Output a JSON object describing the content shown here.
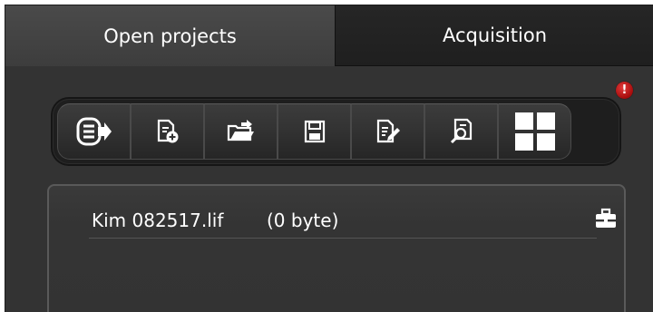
{
  "tabs": [
    {
      "label": "Open projects",
      "active": true
    },
    {
      "label": "Acquisition",
      "active": false
    }
  ],
  "notification": {
    "symbol": "!",
    "color": "#c8161d"
  },
  "toolbar": {
    "buttons": [
      {
        "icon": "list-export-icon"
      },
      {
        "icon": "new-file-icon"
      },
      {
        "icon": "open-folder-icon"
      },
      {
        "icon": "save-icon"
      },
      {
        "icon": "edit-document-icon"
      },
      {
        "icon": "search-document-icon"
      },
      {
        "icon": "grid-layout-icon"
      }
    ]
  },
  "projects": [
    {
      "name": "Kim 082517.lif",
      "size": "(0 byte)",
      "action_icon": "briefcase-icon"
    }
  ]
}
